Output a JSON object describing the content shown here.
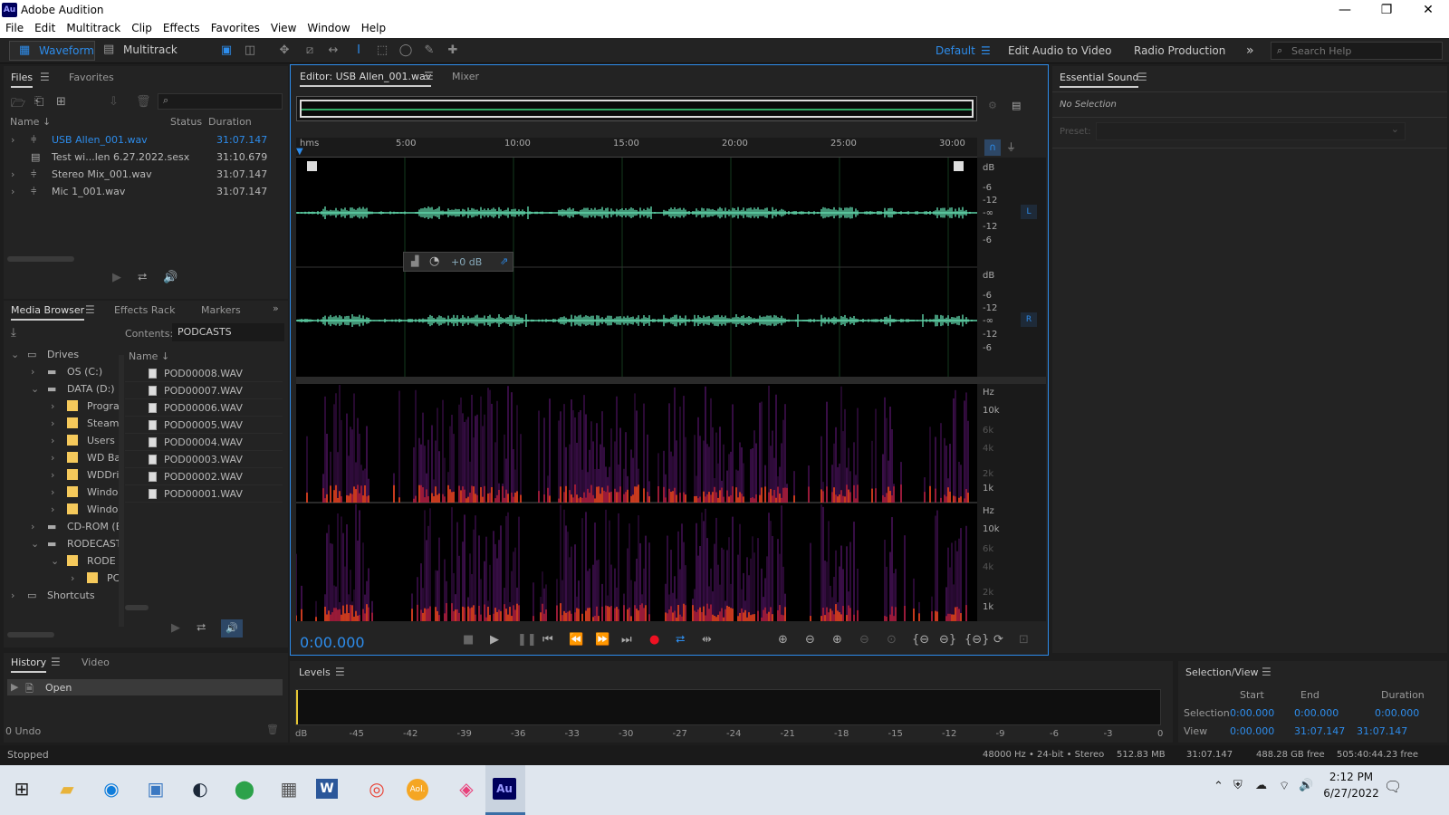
{
  "window": {
    "title": "Adobe Audition",
    "logo": "Au",
    "controls": [
      "—",
      "❐",
      "✕"
    ]
  },
  "menu": [
    "File",
    "Edit",
    "Multitrack",
    "Clip",
    "Effects",
    "Favorites",
    "View",
    "Window",
    "Help"
  ],
  "toolbar": {
    "waveform": "Waveform",
    "multitrack": "Multitrack",
    "workspace_default": "Default",
    "edit_audio_to_video": "Edit Audio to Video",
    "radio_production": "Radio Production",
    "more": "»",
    "search_placeholder": "Search Help"
  },
  "files_panel": {
    "tabs": [
      "Files",
      "Favorites"
    ],
    "col_name": "Name",
    "col_status": "Status",
    "col_duration": "Duration",
    "items": [
      {
        "name": "USB Allen_001.wav",
        "duration": "31:07.147",
        "selected": true
      },
      {
        "name": "Test wi...len 6.27.2022.sesx",
        "duration": "31:10.679"
      },
      {
        "name": "Stereo Mix_001.wav",
        "duration": "31:07.147"
      },
      {
        "name": "Mic 1_001.wav",
        "duration": "31:07.147"
      }
    ]
  },
  "media_browser": {
    "tabs": [
      "Media Browser",
      "Effects Rack",
      "Markers"
    ],
    "contents_label": "Contents:",
    "contents_value": "PODCASTS",
    "name_col": "Name",
    "tree": [
      {
        "label": "Drives",
        "indent": 0,
        "open": true
      },
      {
        "label": "OS (C:)",
        "indent": 1
      },
      {
        "label": "DATA (D:)",
        "indent": 1,
        "open": true
      },
      {
        "label": "Progra",
        "indent": 2,
        "folder": true
      },
      {
        "label": "Steam",
        "indent": 2,
        "folder": true
      },
      {
        "label": "Users",
        "indent": 2,
        "folder": true
      },
      {
        "label": "WD Ba",
        "indent": 2,
        "folder": true
      },
      {
        "label": "WDDri",
        "indent": 2,
        "folder": true
      },
      {
        "label": "Windo",
        "indent": 2,
        "folder": true
      },
      {
        "label": "Windo",
        "indent": 2,
        "folder": true
      },
      {
        "label": "CD-ROM (E",
        "indent": 1
      },
      {
        "label": "RODECAST",
        "indent": 1,
        "open": true
      },
      {
        "label": "RODE",
        "indent": 2,
        "folder": true,
        "open": true
      },
      {
        "label": "PC",
        "indent": 3,
        "folder": true
      },
      {
        "label": "Shortcuts",
        "indent": 0
      }
    ],
    "files": [
      "POD00008.WAV",
      "POD00007.WAV",
      "POD00006.WAV",
      "POD00005.WAV",
      "POD00004.WAV",
      "POD00003.WAV",
      "POD00002.WAV",
      "POD00001.WAV"
    ]
  },
  "history": {
    "tabs": [
      "History",
      "Video"
    ],
    "item": "Open",
    "undo": "0 Undo"
  },
  "editor": {
    "tab": "Editor: USB Allen_001.wav",
    "mixer": "Mixer",
    "ruler": [
      "hms",
      "5:00",
      "10:00",
      "15:00",
      "20:00",
      "25:00",
      "30:00"
    ],
    "db_labels": [
      "dB",
      "-6",
      "-12",
      "-∞",
      "-12",
      "-6"
    ],
    "channels": [
      "L",
      "R"
    ],
    "hud_gain": "+0 dB",
    "hz_labels": [
      "Hz",
      "10k",
      "6k",
      "4k",
      "2k",
      "1k"
    ],
    "time": "0:00.000"
  },
  "essential_sound": {
    "title": "Essential Sound",
    "no_selection": "No Selection",
    "preset": "Preset:"
  },
  "levels": {
    "title": "Levels",
    "scale": [
      "dB",
      "-45",
      "-42",
      "-39",
      "-36",
      "-33",
      "-30",
      "-27",
      "-24",
      "-21",
      "-18",
      "-15",
      "-12",
      "-9",
      "-6",
      "-3",
      "0"
    ]
  },
  "selection_view": {
    "title": "Selection/View",
    "headers": [
      "Start",
      "End",
      "Duration"
    ],
    "rows": [
      {
        "label": "Selection",
        "start": "0:00.000",
        "end": "0:00.000",
        "duration": "0:00.000"
      },
      {
        "label": "View",
        "start": "0:00.000",
        "end": "31:07.147",
        "duration": "31:07.147"
      }
    ]
  },
  "status": {
    "left": "Stopped",
    "format": "48000 Hz • 24-bit • Stereo",
    "size": "512.83 MB",
    "duration": "31:07.147",
    "free": "488.28 GB free",
    "free_time": "505:40:44.23 free"
  },
  "taskbar": {
    "time": "2:12 PM",
    "date": "6/27/2022",
    "aol": "Aol.",
    "au": "Au",
    "word": "W"
  }
}
